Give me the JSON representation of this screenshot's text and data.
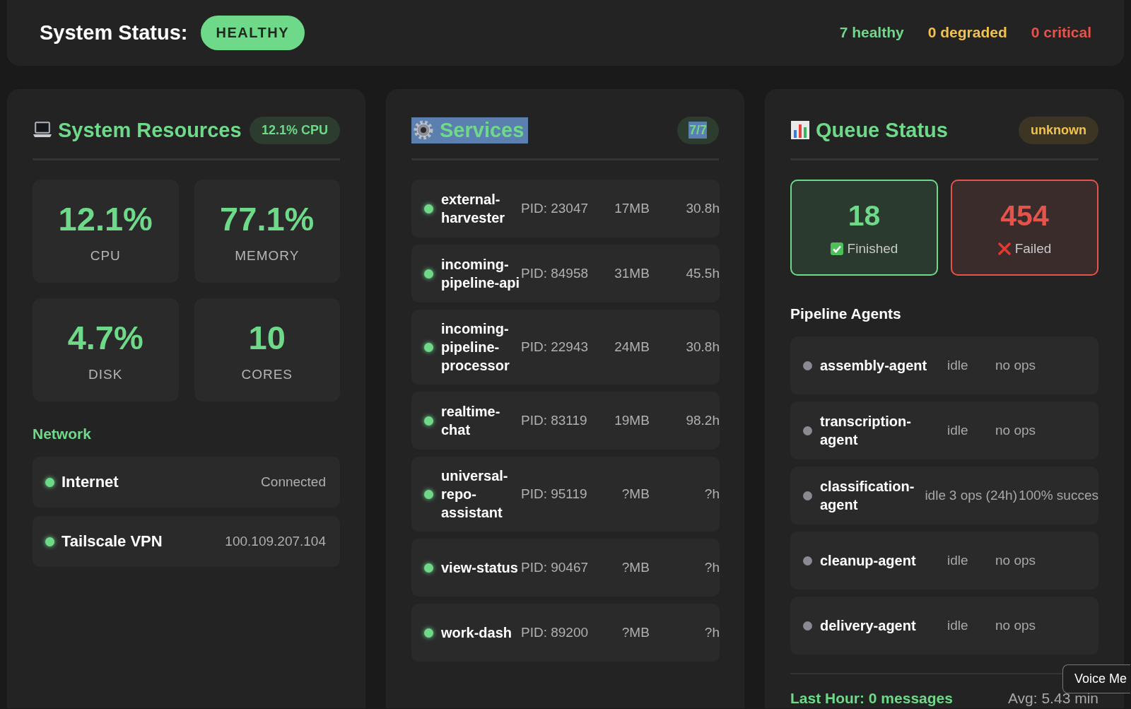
{
  "header": {
    "title": "System Status:",
    "status": "HEALTHY",
    "counts": [
      {
        "label": "7 healthy",
        "color": "#6fd98a"
      },
      {
        "label": "0 degraded",
        "color": "#f2c14e"
      },
      {
        "label": "0 critical",
        "color": "#e5534b"
      }
    ]
  },
  "resources": {
    "title": "System Resources",
    "badge": "12.1% CPU",
    "metrics": [
      {
        "value": "12.1%",
        "label": "CPU"
      },
      {
        "value": "77.1%",
        "label": "MEMORY"
      },
      {
        "value": "4.7%",
        "label": "DISK"
      },
      {
        "value": "10",
        "label": "CORES"
      }
    ],
    "network_title": "Network",
    "network": [
      {
        "name": "Internet",
        "value": "Connected",
        "color": "#6fd98a"
      },
      {
        "name": "Tailscale VPN",
        "value": "100.109.207.104",
        "color": "#6fd98a"
      }
    ]
  },
  "services": {
    "title": "Services",
    "badge": "7/7",
    "highlighted": true,
    "rows": [
      {
        "name": "external-harvester",
        "pid": "PID: 23047",
        "memory": "17MB",
        "uptime": "30.8h",
        "color": "#6fd98a"
      },
      {
        "name": "incoming-pipeline-api",
        "pid": "PID: 84958",
        "memory": "31MB",
        "uptime": "45.5h",
        "color": "#6fd98a"
      },
      {
        "name": "incoming-pipeline-processor",
        "pid": "PID: 22943",
        "memory": "24MB",
        "uptime": "30.8h",
        "color": "#6fd98a"
      },
      {
        "name": "realtime-chat",
        "pid": "PID: 83119",
        "memory": "19MB",
        "uptime": "98.2h",
        "color": "#6fd98a"
      },
      {
        "name": "universal-repo-assistant",
        "pid": "PID: 95119",
        "memory": "?MB",
        "uptime": "?h",
        "color": "#6fd98a"
      },
      {
        "name": "view-status",
        "pid": "PID: 90467",
        "memory": "?MB",
        "uptime": "?h",
        "color": "#6fd98a"
      },
      {
        "name": "work-dash",
        "pid": "PID: 89200",
        "memory": "?MB",
        "uptime": "?h",
        "color": "#6fd98a"
      }
    ]
  },
  "queue": {
    "title": "Queue Status",
    "badge": "unknown",
    "tiles": [
      {
        "kind": "finished",
        "value": "18",
        "label": "Finished"
      },
      {
        "kind": "failed",
        "value": "454",
        "label": "Failed"
      }
    ],
    "agents_title": "Pipeline Agents",
    "agents": [
      {
        "name": "assembly-agent",
        "state": "idle",
        "ops": "no ops",
        "color": "#8a8a92"
      },
      {
        "name": "transcription-agent",
        "state": "idle",
        "ops": "no ops",
        "color": "#8a8a92"
      },
      {
        "name": "classification-agent",
        "state": "idle",
        "ops": "3 ops (24h)",
        "rate": "100% succes",
        "color": "#8a8a92"
      },
      {
        "name": "cleanup-agent",
        "state": "idle",
        "ops": "no ops",
        "color": "#8a8a92"
      },
      {
        "name": "delivery-agent",
        "state": "idle",
        "ops": "no ops",
        "color": "#8a8a92"
      }
    ],
    "footer": {
      "last_hour": "Last Hour: 0 messages",
      "avg": "Avg: 5.43 min"
    }
  },
  "tooltip": {
    "text": "Voice Me"
  }
}
